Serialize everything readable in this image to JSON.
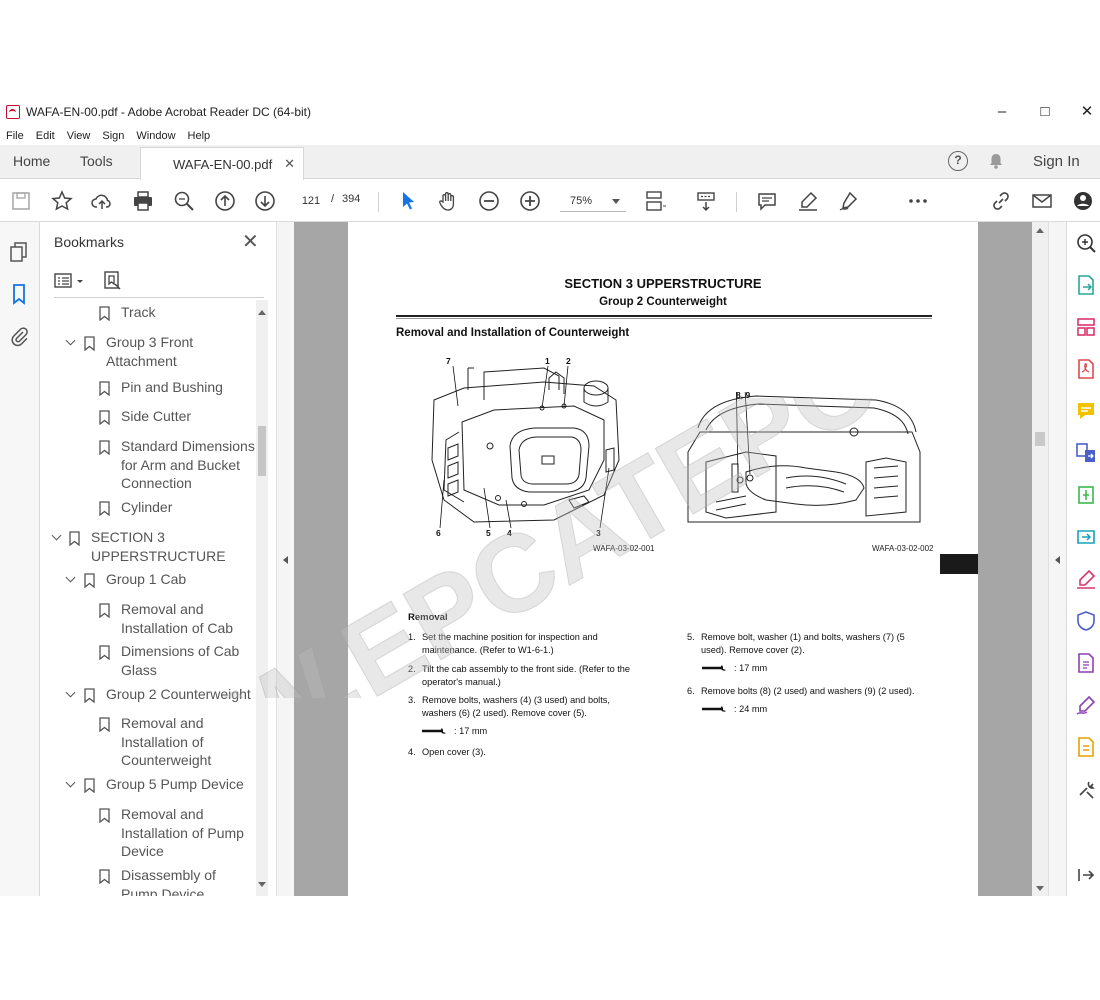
{
  "window": {
    "title": "WAFA-EN-00.pdf - Adobe Acrobat Reader DC (64-bit)"
  },
  "menu": [
    "File",
    "Edit",
    "View",
    "Sign",
    "Window",
    "Help"
  ],
  "tabs": {
    "home": "Home",
    "tools": "Tools",
    "document": "WAFA-EN-00.pdf",
    "signin": "Sign In"
  },
  "toolbar": {
    "page_current": "121",
    "page_separator": "/",
    "page_total": "394",
    "zoom": "75%"
  },
  "bookmarks": {
    "title": "Bookmarks",
    "items": [
      {
        "label": "Track",
        "level": 2,
        "expandable": false
      },
      {
        "label": "Group 3 Front Attachment",
        "level": 1,
        "expandable": true
      },
      {
        "label": "Pin and Bushing",
        "level": 2,
        "expandable": false
      },
      {
        "label": "Side Cutter",
        "level": 2,
        "expandable": false
      },
      {
        "label": "Standard Dimensions for Arm and Bucket Connection",
        "level": 2,
        "expandable": false
      },
      {
        "label": "Cylinder",
        "level": 2,
        "expandable": false
      },
      {
        "label": "SECTION 3 UPPERSTRUCTURE",
        "level": 0,
        "expandable": true
      },
      {
        "label": "Group 1 Cab",
        "level": 1,
        "expandable": true
      },
      {
        "label": "Removal and Installation of Cab",
        "level": 2,
        "expandable": false
      },
      {
        "label": "Dimensions of Cab Glass",
        "level": 2,
        "expandable": false
      },
      {
        "label": "Group 2 Counterweight",
        "level": 1,
        "expandable": true
      },
      {
        "label": "Removal and Installation of Counterweight",
        "level": 2,
        "expandable": false
      },
      {
        "label": "Group 5 Pump Device",
        "level": 1,
        "expandable": true
      },
      {
        "label": "Removal and Installation of Pump Device",
        "level": 2,
        "expandable": false
      },
      {
        "label": "Disassembly of Pump Device",
        "level": 2,
        "expandable": false
      }
    ]
  },
  "page": {
    "section_title": "SECTION 3 UPPERSTRUCTURE",
    "group_title": "Group 2 Counterweight",
    "heading": "Removal and Installation of Counterweight",
    "figure1": {
      "code": "WAFA-03-02-001",
      "callouts": [
        "7",
        "1",
        "2",
        "6",
        "5",
        "4",
        "3"
      ]
    },
    "figure2": {
      "code": "WAFA-03-02-002",
      "callouts": [
        "8, 9"
      ]
    },
    "removal_heading": "Removal",
    "steps_left": [
      {
        "num": "1.",
        "text": "Set the machine position for inspection and maintenance. (Refer to W1-6-1.)"
      },
      {
        "num": "2.",
        "text": "Tilt the cab assembly to the front side. (Refer to the operator's manual.)"
      },
      {
        "num": "3.",
        "text": "Remove bolts, washers (4) (3 used) and bolts, washers (6) (2 used). Remove cover (5)."
      },
      {
        "num": "4.",
        "text": "Open cover (3)."
      }
    ],
    "torque_left": ": 17 mm",
    "steps_right": [
      {
        "num": "5.",
        "text": "Remove bolt, washer (1) and bolts, washers (7) (5 used). Remove cover (2)."
      },
      {
        "num": "6.",
        "text": "Remove bolts (8) (2 used) and washers (9) (2 used)."
      }
    ],
    "torque_right_5": ": 17 mm",
    "torque_right_6": ": 24 mm"
  },
  "watermark": "WWW.EPCATEPO.COM",
  "colors": {
    "accent": "#c8102e",
    "doc_bg": "#a6a6a6",
    "rail_purple": "#8e3fb5"
  }
}
